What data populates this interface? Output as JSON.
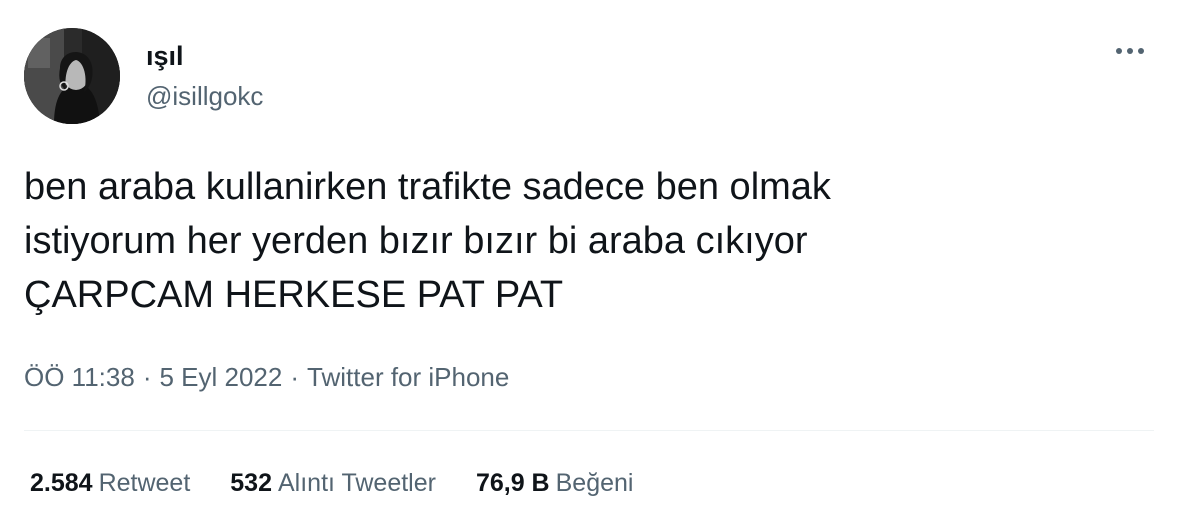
{
  "user": {
    "display_name": "ışıl",
    "handle": "@isillgokc"
  },
  "icons": {
    "more": "more-horizontal-icon",
    "avatar": "profile-photo"
  },
  "tweet": {
    "lines": [
      "ben araba kullanirken trafikte sadece ben olmak",
      "istiyorum her yerden bızır bızır bi araba cıkıyor",
      "ÇARPCAM HERKESE PAT PAT"
    ]
  },
  "meta": {
    "time": "ÖÖ 11:38",
    "separator": "·",
    "date": "5 Eyl 2022",
    "source": "Twitter for iPhone"
  },
  "stats": {
    "retweets": {
      "count": "2.584",
      "label": "Retweet"
    },
    "quotes": {
      "count": "532",
      "label": "Alıntı Tweetler"
    },
    "likes": {
      "count": "76,9 B",
      "label": "Beğeni"
    }
  },
  "colors": {
    "text_primary": "#0f1419",
    "text_secondary": "#536471",
    "divider": "#eff3f4"
  }
}
